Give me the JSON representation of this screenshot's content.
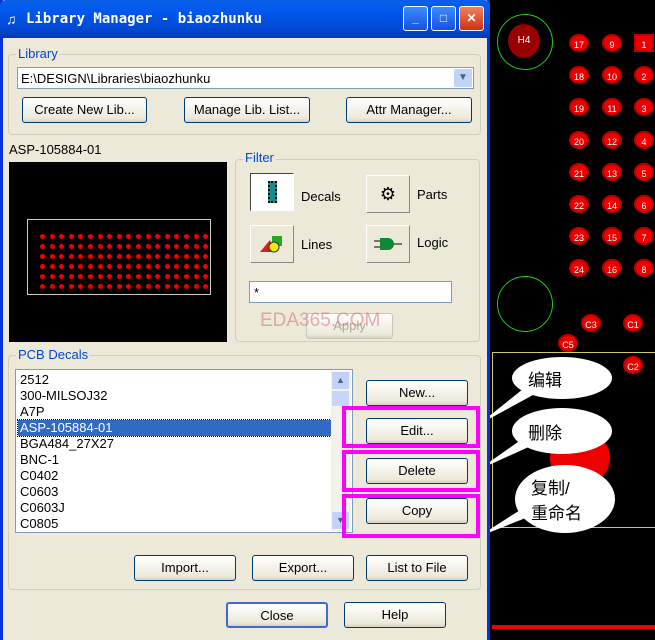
{
  "window": {
    "title": "Library Manager - biaozhunku",
    "minimize": "_",
    "maximize": "□",
    "close": "✕"
  },
  "library": {
    "legend": "Library",
    "path": "E:\\DESIGN\\Libraries\\biaozhunku",
    "create_new": "Create New Lib...",
    "manage_list": "Manage Lib. List...",
    "attr_manager": "Attr Manager..."
  },
  "preview": {
    "name": "ASP-105884-01"
  },
  "filter": {
    "legend": "Filter",
    "decals": "Decals",
    "parts": "Parts",
    "lines": "Lines",
    "logic": "Logic",
    "pattern": "*",
    "apply": "Apply",
    "watermark": "EDA365.COM"
  },
  "decals": {
    "legend": "PCB Decals",
    "items": [
      "2512",
      "300-MILSOJ32",
      "A7P",
      "ASP-105884-01",
      "BGA484_27X27",
      "BNC-1",
      "C0402",
      "C0603",
      "C0603J",
      "C0805"
    ],
    "selected": "ASP-105884-01",
    "new": "New...",
    "edit": "Edit...",
    "delete": "Delete",
    "copy": "Copy",
    "import": "Import...",
    "export": "Export...",
    "list_to_file": "List to File"
  },
  "footer": {
    "close": "Close",
    "help": "Help"
  },
  "annotations": {
    "edit": "编辑",
    "delete": "删除",
    "copy_line1": "复制/",
    "copy_line2": "重命名"
  },
  "pcb": {
    "mounting_hole": "H4",
    "pad_columns": [
      [
        "17",
        "18",
        "19",
        "20",
        "21",
        "22",
        "23",
        "24"
      ],
      [
        "9",
        "10",
        "11",
        "12",
        "13",
        "14",
        "15",
        "16"
      ],
      [
        "1",
        "2",
        "3",
        "4",
        "5",
        "6",
        "7",
        "8"
      ]
    ],
    "caps": [
      "C3",
      "C1",
      "C5",
      "C2"
    ]
  },
  "colors": {
    "highlight": "#ff00ff",
    "selection": "#316ac5",
    "pad": "#e00000"
  }
}
